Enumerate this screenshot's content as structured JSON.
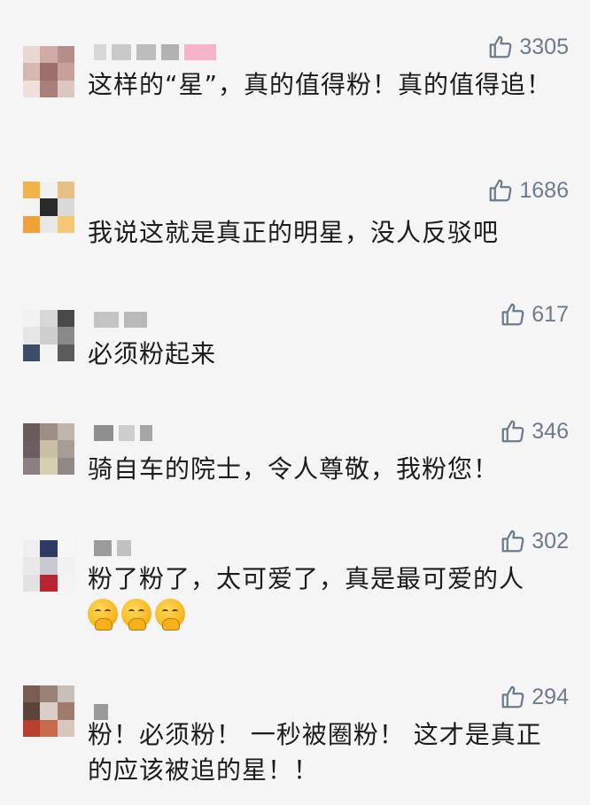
{
  "comments": [
    {
      "avatar_colors": [
        "#e9d7d3",
        "#cfaaa6",
        "#b58d8a",
        "#d6b7b1",
        "#9d6f6c",
        "#c89f99",
        "#efe0dc",
        "#a88079",
        "#dcc6c1"
      ],
      "name_colors": [
        "#d8d8d8",
        "#c9c9c9",
        "#bdbdbd",
        "#b2b2b2",
        "#f7b3c9"
      ],
      "likes": "3305",
      "text": "这样的“星”，真的值得粉！真的值得追！",
      "emoji_count": 0
    },
    {
      "avatar_colors": [
        "#f4b24a",
        "#f1f1f1",
        "#e7c084",
        "#f4f4f4",
        "#2a2a2a",
        "#d9d9d9",
        "#f0a23a",
        "#e8e8e8",
        "#f7c775"
      ],
      "name_colors": [],
      "likes": "1686",
      "text": "我说这就是真正的明星，没人反驳吧",
      "emoji_count": 0
    },
    {
      "avatar_colors": [
        "#f2f2f2",
        "#d7d7d7",
        "#4a4a4a",
        "#e6e6e6",
        "#cfcfcf",
        "#8a8a8a",
        "#3c4b66",
        "#f3f3f3",
        "#5c5c5c"
      ],
      "name_colors": [
        "#c3c3c3",
        "#b9b9b9"
      ],
      "likes": "617",
      "text": "必须粉起来",
      "emoji_count": 0
    },
    {
      "avatar_colors": [
        "#6b5a5a",
        "#9b8f86",
        "#bfb6ae",
        "#6d5d62",
        "#cabea6",
        "#a59d96",
        "#8c7f80",
        "#d5d0b0",
        "#8f8a86"
      ],
      "name_colors": [
        "#8f8f8f",
        "#cdcdcd",
        "#a6a6a6"
      ],
      "likes": "346",
      "text": "骑自车的院士，令人尊敬，我粉您！",
      "emoji_count": 0
    },
    {
      "avatar_colors": [
        "#f0f0f0",
        "#2e3a66",
        "#f6f6f6",
        "#e9e9e9",
        "#c9c9d4",
        "#f1f1f1",
        "#e2e2e2",
        "#b8242f",
        "#f3f3f3"
      ],
      "name_colors": [
        "#9b9b9b",
        "#c1c1c1"
      ],
      "likes": "302",
      "text": "粉了粉了，太可爱了，真是最可爱的人",
      "emoji_count": 3
    },
    {
      "avatar_colors": [
        "#7a5d52",
        "#9a8276",
        "#c7c0ba",
        "#5d4438",
        "#d9cec8",
        "#a07a6a",
        "#b7402e",
        "#c96a4a",
        "#d6c7bf"
      ],
      "name_colors": [
        "#9a9a9a"
      ],
      "likes": "294",
      "text": "粉！必须粉！ 一秒被圈粉！ 这才是真正的应该被追的星！！",
      "emoji_count": 0
    }
  ]
}
